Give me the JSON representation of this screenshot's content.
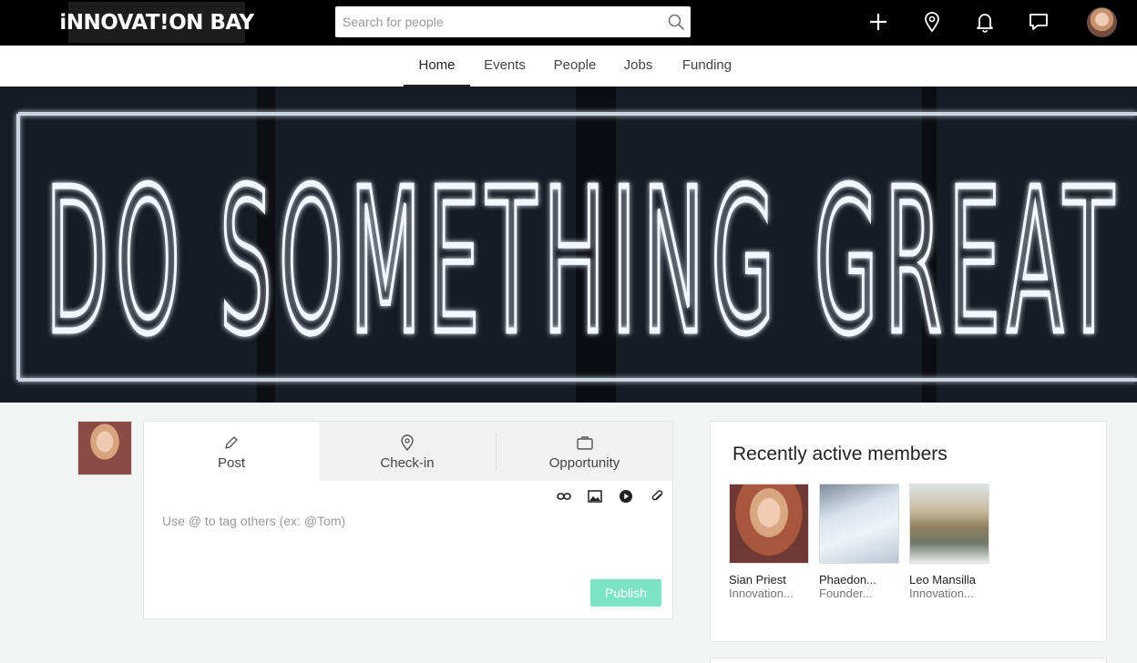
{
  "header": {
    "logo_text": "iNNOVAT!ON BAY",
    "search_placeholder": "Search for people",
    "icons": [
      "plus-icon",
      "location-pin-icon",
      "bell-icon",
      "chat-icon",
      "avatar"
    ]
  },
  "nav": {
    "items": [
      {
        "label": "Home",
        "active": true
      },
      {
        "label": "Events",
        "active": false
      },
      {
        "label": "People",
        "active": false
      },
      {
        "label": "Jobs",
        "active": false
      },
      {
        "label": "Funding",
        "active": false
      }
    ]
  },
  "hero": {
    "image_text": "DO SOMETHING GREAT"
  },
  "composer": {
    "tabs": [
      {
        "label": "Post",
        "icon": "pencil-icon",
        "active": true
      },
      {
        "label": "Check-in",
        "icon": "location-pin-icon",
        "active": false
      },
      {
        "label": "Opportunity",
        "icon": "briefcase-icon",
        "active": false
      }
    ],
    "tools": [
      "link-icon",
      "image-icon",
      "play-icon",
      "attachment-icon"
    ],
    "placeholder": "Use @ to tag others (ex: @Tom)",
    "publish_label": "Publish"
  },
  "members": {
    "title": "Recently active members",
    "list": [
      {
        "name": "Sian Priest",
        "role": "Innovation..."
      },
      {
        "name": "Phaedon...",
        "role": "Founder..."
      },
      {
        "name": "Leo Mansilla",
        "role": "Innovation..."
      }
    ]
  },
  "colors": {
    "topbar": "#000000",
    "publish": "#7ce3c5",
    "neon": "#e8f4ff"
  }
}
